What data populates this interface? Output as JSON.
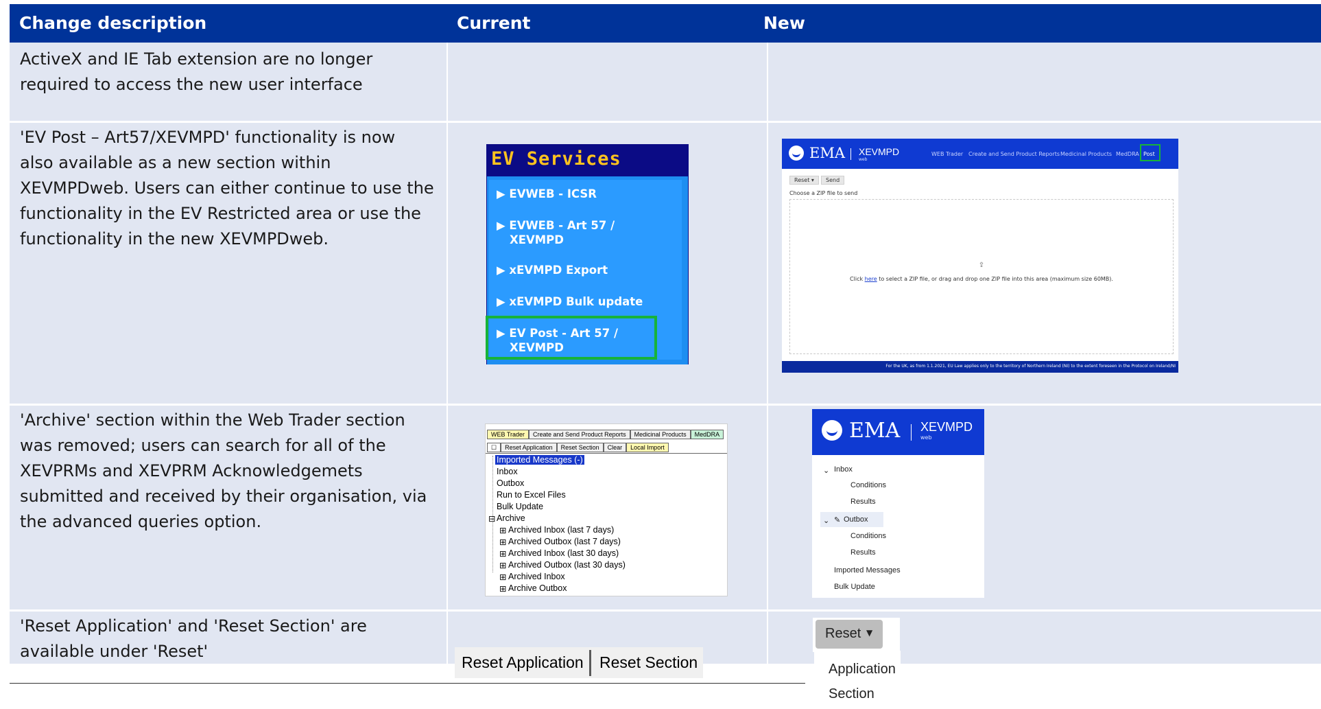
{
  "header": {
    "col1": "Change description",
    "col2": "Current",
    "col3": "New"
  },
  "rows": [
    {
      "desc_lines": [
        "ActiveX and IE Tab extension are no longer",
        "required to access the new user interface"
      ]
    },
    {
      "desc_lines": [
        "'EV Post – Art57/XEVMPD' functionality is now",
        "also available as a new section within",
        "XEVMPDweb. Users can either continue to use the",
        "functionality in the EV Restricted area or use the",
        "functionality in the new XEVMPDweb."
      ],
      "current": {
        "title": "EV Services",
        "items": [
          [
            "▶ EVWEB - ICSR"
          ],
          [
            "▶ EVWEB - Art 57 /",
            "XEVMPD"
          ],
          [
            "▶ xEVMPD Export"
          ],
          [
            "▶ xEVMPD Bulk update"
          ],
          [
            "▶ EV Post - Art 57 /",
            "XEVMPD"
          ]
        ]
      },
      "new": {
        "logo": "EMA",
        "app": "XEVMPD",
        "app_sub": "web",
        "nav": [
          "WEB Trader",
          "Create and Send Product Reports",
          "Medicinal Products",
          "MedDRA",
          "Post"
        ],
        "buttons": [
          "Reset ▾",
          "Send"
        ],
        "choose_label": "Choose a ZIP file to send",
        "upload_icon": "upload-icon",
        "drop_text_pre": "Click ",
        "drop_link": "here",
        "drop_text_post": " to select a ZIP file, or drag and drop one ZIP file into this area (maximum size 60MB).",
        "footer": "For the UK, as from 1.1.2021, EU Law applies only to the territory of Northern Ireland (NI) to the extent foreseen in the Protocol on Ireland/NI"
      }
    },
    {
      "desc_lines": [
        "'Archive' section within the Web Trader section",
        "was removed; users can search for all of the",
        "XEVPRMs and XEVPRM Acknowledgemets",
        "submitted and received by their organisation, via",
        "the advanced queries option."
      ],
      "current": {
        "tabs": [
          "WEB Trader",
          "Create and Send Product Reports",
          "Medicinal Products",
          "MedDRA"
        ],
        "toolbar": [
          "Reset Application",
          "Reset Section",
          "Clear",
          "Local Import"
        ],
        "tree": [
          "Imported Messages (-)",
          "Inbox",
          "Outbox",
          "Run to Excel Files",
          "Bulk Update",
          "Archive",
          "Archived Inbox (last 7 days)",
          "Archived Outbox (last 7 days)",
          "Archived Inbox (last 30 days)",
          "Archived Outbox (last 30 days)",
          "Archived Inbox",
          "Archive Outbox"
        ]
      },
      "new": {
        "logo": "EMA",
        "app": "XEVMPD",
        "app_sub": "web",
        "tree": [
          "Inbox",
          "Conditions",
          "Results",
          "Outbox",
          "Conditions",
          "Results",
          "Imported Messages",
          "Bulk Update"
        ]
      }
    },
    {
      "desc_lines": [
        "'Reset Application' and 'Reset Section' are",
        "available under 'Reset'"
      ],
      "current": {
        "buttons": [
          "Reset Application",
          "Reset Section"
        ]
      },
      "new": {
        "button": "Reset",
        "menu": [
          "Application",
          "Section"
        ]
      }
    }
  ]
}
